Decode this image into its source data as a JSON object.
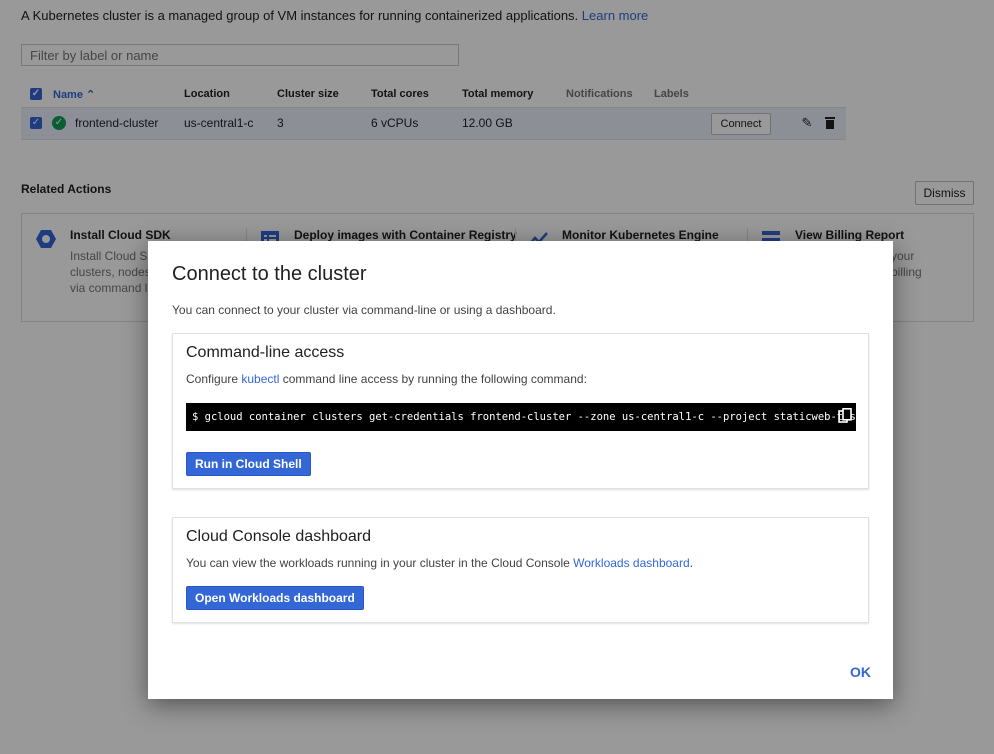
{
  "page": {
    "intro_text": "A Kubernetes cluster is a managed group of VM instances for running containerized applications.",
    "learn_more": "Learn more",
    "filter_placeholder": "Filter by label or name"
  },
  "table": {
    "headers": {
      "name": "Name",
      "location": "Location",
      "cluster_size": "Cluster size",
      "total_cores": "Total cores",
      "total_memory": "Total memory",
      "notifications": "Notifications",
      "labels": "Labels"
    },
    "rows": [
      {
        "name": "frontend-cluster",
        "location": "us-central1-c",
        "cluster_size": "3",
        "total_cores": "6 vCPUs",
        "total_memory": "12.00 GB",
        "connect_label": "Connect"
      }
    ]
  },
  "related": {
    "title": "Related Actions",
    "dismiss_label": "Dismiss",
    "cards": [
      {
        "icon": "hexagon-icon",
        "title": "Install Cloud SDK",
        "desc_lines": [
          "Install Cloud S",
          "clusters, nodes",
          "via command l"
        ]
      },
      {
        "icon": "container-registry-icon",
        "title": "Deploy images with Container Registry"
      },
      {
        "icon": "monitoring-chart-icon",
        "title": "Monitor Kubernetes Engine"
      },
      {
        "icon": "billing-card-icon",
        "title": "View Billing Report",
        "desc_lines": [
          "your",
          "billing"
        ]
      }
    ]
  },
  "dialog": {
    "title": "Connect to the cluster",
    "subtitle": "You can connect to your cluster via command-line or using a dashboard.",
    "cli": {
      "title": "Command-line access",
      "text_before": "Configure",
      "kubectl": "kubectl",
      "text_after": "command line access by running the following command:",
      "command": "$ gcloud container clusters get-credentials frontend-cluster --zone us-central1-c --project staticweb-test",
      "run_button": "Run in Cloud Shell"
    },
    "dashboard": {
      "title": "Cloud Console dashboard",
      "text_before": "You can view the workloads running in your cluster in the Cloud Console",
      "workloads_link": "Workloads dashboard",
      "text_after": ".",
      "open_button": "Open Workloads dashboard"
    },
    "ok_label": "OK"
  },
  "colors": {
    "accent": "#3367d6",
    "success": "#0f9d58",
    "scrim": "#000000"
  }
}
